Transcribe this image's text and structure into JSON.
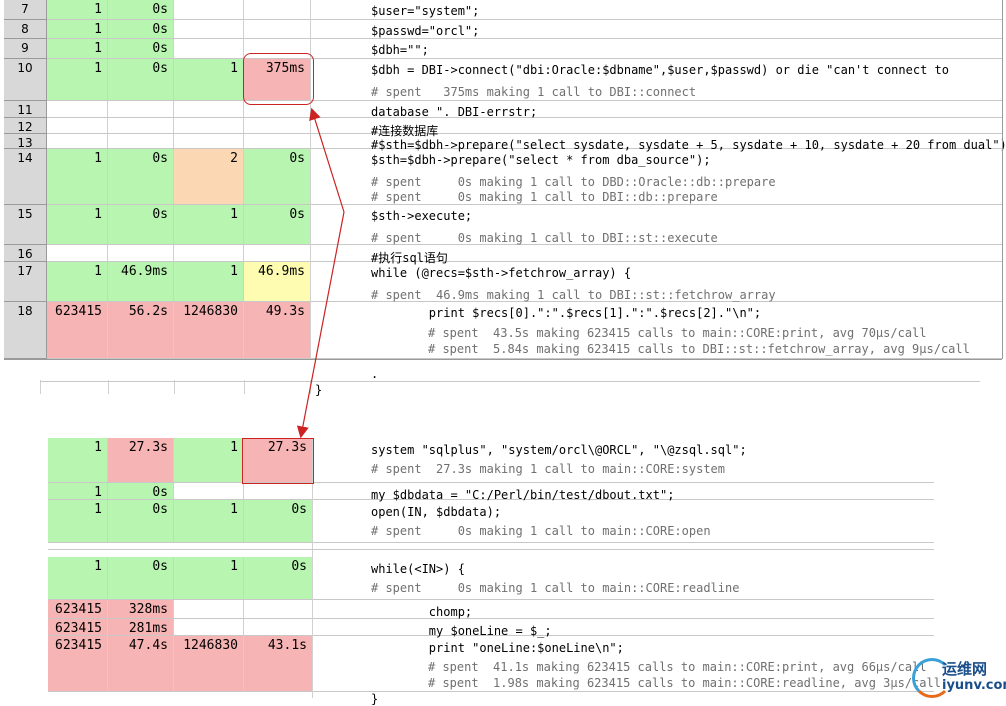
{
  "top_table": [
    {
      "line": "7",
      "calls": "1",
      "excl": "0s",
      "subcalls": "",
      "incl": "",
      "code": "$user=\"system\";",
      "comments": []
    },
    {
      "line": "8",
      "calls": "1",
      "excl": "0s",
      "subcalls": "",
      "incl": "",
      "code": "$passwd=\"orcl\";",
      "comments": []
    },
    {
      "line": "9",
      "calls": "1",
      "excl": "0s",
      "subcalls": "",
      "incl": "",
      "code": "$dbh=\"\";",
      "comments": []
    },
    {
      "line": "10",
      "calls": "1",
      "excl": "0s",
      "subcalls": "1",
      "incl": "375ms",
      "code": "$dbh = DBI->connect(\"dbi:Oracle:$dbname\",$user,$passwd) or die \"can't connect to",
      "comments": [
        "# spent   375ms making 1 call to DBI::connect"
      ]
    },
    {
      "line": "11",
      "calls": "",
      "excl": "",
      "subcalls": "",
      "incl": "",
      "code": "database \". DBI-errstr;",
      "comments": []
    },
    {
      "line": "12",
      "calls": "",
      "excl": "",
      "subcalls": "",
      "incl": "",
      "code": "#连接数据库",
      "comments": []
    },
    {
      "line": "13",
      "calls": "",
      "excl": "",
      "subcalls": "",
      "incl": "",
      "code": "#$sth=$dbh->prepare(\"select sysdate, sysdate + 5, sysdate + 10, sysdate + 20 from dual\");",
      "comments": []
    },
    {
      "line": "14",
      "calls": "1",
      "excl": "0s",
      "subcalls": "2",
      "incl": "0s",
      "code": "$sth=$dbh->prepare(\"select * from dba_source\");",
      "comments": [
        "# spent     0s making 1 call to DBD::Oracle::db::prepare",
        "# spent     0s making 1 call to DBI::db::prepare"
      ]
    },
    {
      "line": "15",
      "calls": "1",
      "excl": "0s",
      "subcalls": "1",
      "incl": "0s",
      "code": "$sth->execute;",
      "comments": [
        "# spent     0s making 1 call to DBI::st::execute"
      ]
    },
    {
      "line": "16",
      "calls": "",
      "excl": "",
      "subcalls": "",
      "incl": "",
      "code": "#执行sql语句",
      "comments": []
    },
    {
      "line": "17",
      "calls": "1",
      "excl": "46.9ms",
      "subcalls": "1",
      "incl": "46.9ms",
      "code": "while (@recs=$sth->fetchrow_array) {",
      "comments": [
        "# spent  46.9ms making 1 call to DBI::st::fetchrow_array"
      ]
    },
    {
      "line": "18",
      "calls": "623415",
      "excl": "56.2s",
      "subcalls": "1246830",
      "incl": "49.3s",
      "code": "        print $recs[0].\":\".$recs[1].\":\".$recs[2].\"\\n\";",
      "comments": [
        "# spent  43.5s making 623415 calls to main::CORE:print, avg 70µs/call",
        "# spent  5.84s making 623415 calls to DBI::st::fetchrow_array, avg 9µs/call"
      ]
    }
  ],
  "top_tail": {
    "dot": ".",
    "brace": "}"
  },
  "bottom_table": [
    {
      "calls": "1",
      "excl": "27.3s",
      "subcalls": "1",
      "incl": "27.3s",
      "code": "system \"sqlplus\", \"system/orcl\\@ORCL\", \"\\@zsql.sql\";",
      "comments": [
        "# spent  27.3s making 1 call to main::CORE:system"
      ]
    },
    {
      "calls": "1",
      "excl": "0s",
      "subcalls": "",
      "incl": "",
      "code": "my $dbdata = \"C:/Perl/bin/test/dbout.txt\";",
      "comments": []
    },
    {
      "calls": "1",
      "excl": "0s",
      "subcalls": "1",
      "incl": "0s",
      "code": "open(IN, $dbdata);",
      "comments": [
        "# spent     0s making 1 call to main::CORE:open"
      ]
    },
    {
      "calls": "1",
      "excl": "0s",
      "subcalls": "1",
      "incl": "0s",
      "code": "while(<IN>) {",
      "comments": [
        "# spent     0s making 1 call to main::CORE:readline"
      ]
    },
    {
      "calls": "623415",
      "excl": "328ms",
      "subcalls": "",
      "incl": "",
      "code": "        chomp;",
      "comments": []
    },
    {
      "calls": "623415",
      "excl": "281ms",
      "subcalls": "",
      "incl": "",
      "code": "        my $oneLine = $_;",
      "comments": []
    },
    {
      "calls": "623415",
      "excl": "47.4s",
      "subcalls": "1246830",
      "incl": "43.1s",
      "code": "        print \"oneLine:$oneLine\\n\";",
      "comments": [
        "# spent  41.1s making 623415 calls to main::CORE:print, avg 66µs/call",
        "# spent  1.98s making 623415 calls to main::CORE:readline, avg 3µs/call"
      ]
    }
  ],
  "bottom_tail": {
    "brace": "}"
  },
  "watermark": {
    "cn": "运维网",
    "url": "iyunv.com"
  },
  "colors": {
    "fast": "#b8f5b0",
    "slow": "#f7b4b4",
    "medium": "#fbd7b4",
    "warn": "#fdfcb0",
    "highlight": "#cc2222"
  }
}
